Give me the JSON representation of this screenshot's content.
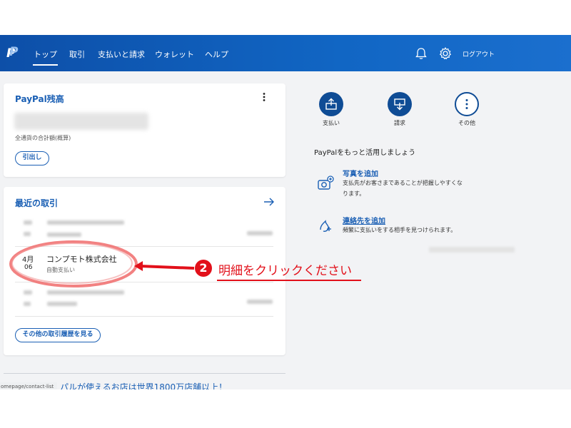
{
  "header": {
    "nav": [
      "トップ",
      "取引",
      "支払いと請求",
      "ウォレット",
      "ヘルプ"
    ],
    "active_nav": "トップ",
    "logout_label": "ログアウト",
    "icons": [
      "paypal-logo",
      "bell-icon",
      "gear-icon"
    ]
  },
  "balance_card": {
    "title": "PayPal残高",
    "caption": "全通貨の合計額(概算)",
    "withdraw_label": "引出し"
  },
  "transactions_card": {
    "title": "最近の取引",
    "rows": [
      {
        "month": "4月",
        "day": "06",
        "name": "コンプモト株式会社",
        "type": "自動支払い"
      }
    ],
    "history_button": "その他の取引履歴を見る"
  },
  "quick_actions": [
    {
      "label": "支払い",
      "icon": "send-money-icon"
    },
    {
      "label": "請求",
      "icon": "request-money-icon"
    },
    {
      "label": "その他",
      "icon": "more-icon"
    }
  ],
  "promo": {
    "heading": "PayPalをもっと活用しましょう",
    "items": [
      {
        "title": "写真を追加",
        "desc1": "支払先がお客さまであることが把握しやすくな",
        "desc2": "ります。",
        "icon": "add-photo-icon"
      },
      {
        "title": "連絡先を追加",
        "desc1": "頻繁に支払いをする相手を見つけられます。",
        "icon": "add-contact-icon"
      }
    ]
  },
  "footer": {
    "url_label": "omepage/contact-list",
    "banner_text": "パルが使えるお店は世界1800万店舗以上！"
  },
  "annotation": {
    "badge": "2",
    "text": "明細をクリックください",
    "color": "#e2101a"
  }
}
